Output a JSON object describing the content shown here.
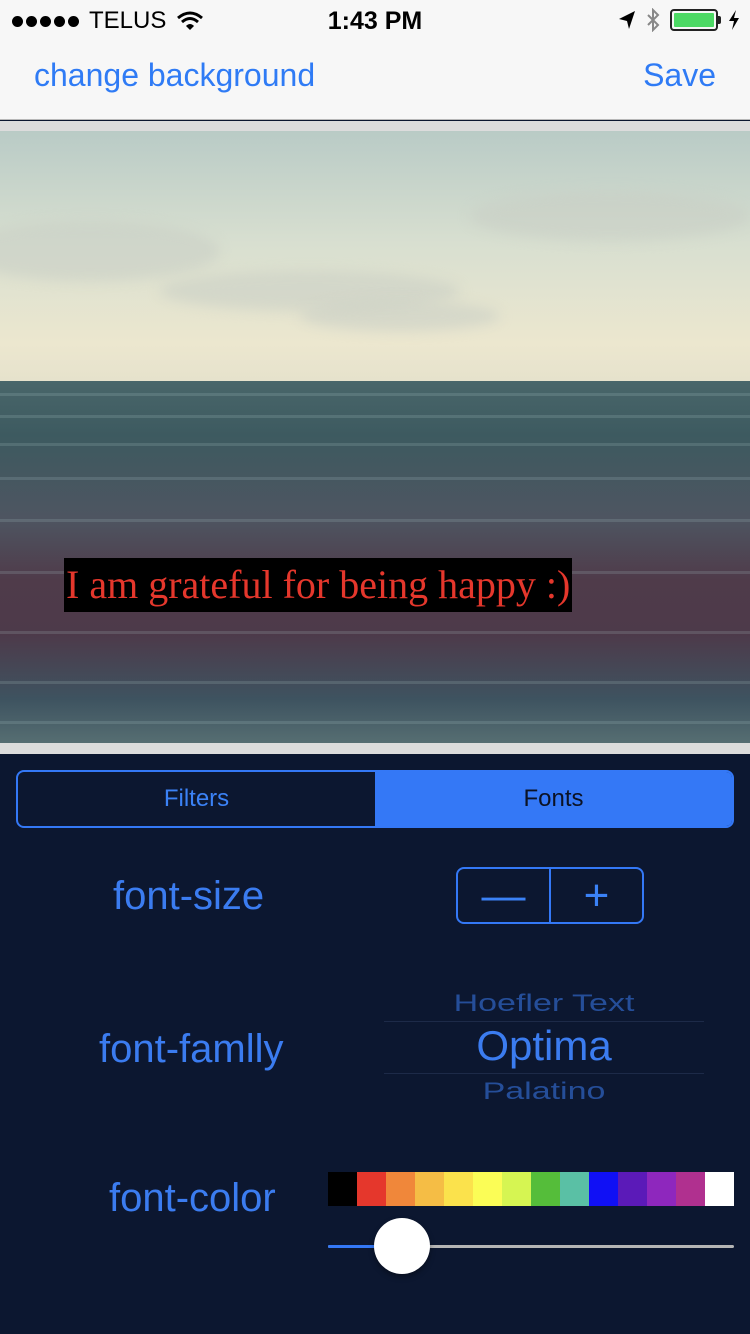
{
  "status_bar": {
    "carrier": "TELUS",
    "time": "1:43 PM",
    "icons": [
      "signal-dots-icon",
      "wifi-icon",
      "location-arrow-icon",
      "bluetooth-icon",
      "battery-icon",
      "charging-bolt-icon"
    ],
    "battery_color": "#4cd964"
  },
  "nav": {
    "left_label": "change background",
    "right_label": "Save"
  },
  "canvas": {
    "caption": "I am grateful for being happy :)",
    "caption_color": "#e5372c",
    "caption_background": "#000000"
  },
  "tabs": {
    "items": [
      {
        "label": "Filters",
        "active": false
      },
      {
        "label": "Fonts",
        "active": true
      }
    ]
  },
  "font_size": {
    "label": "font-size",
    "decrease_symbol": "—",
    "increase_symbol": "+"
  },
  "font_family": {
    "label": "font-famlly",
    "previous": "Hoefler Text",
    "selected": "Optima",
    "next": "Palatino"
  },
  "font_color": {
    "label": "font-color",
    "swatches": [
      "#000000",
      "#e5372c",
      "#f0873a",
      "#f5bd45",
      "#fbe24c",
      "#fbfd56",
      "#d6f552",
      "#55bd3a",
      "#5ac0a5",
      "#1010f5",
      "#5b1ab8",
      "#8e27bd",
      "#b0308f",
      "#ffffff"
    ],
    "slider_value": 0.13
  },
  "accent_color": "#3478f6"
}
